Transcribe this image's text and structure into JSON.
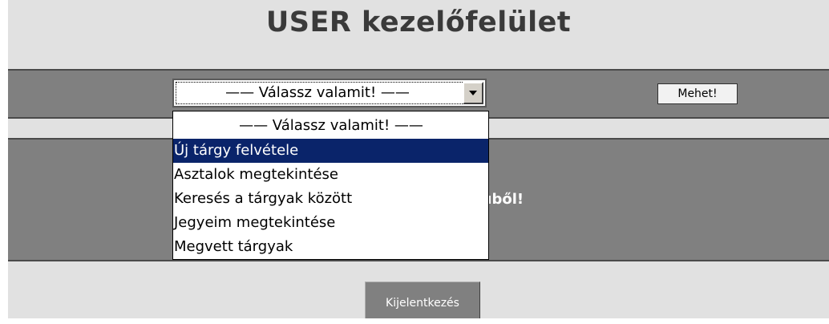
{
  "page": {
    "title": "USER kezelőfelület"
  },
  "menu": {
    "selected_label": "—— Válassz valamit! ——",
    "options": [
      "—— Válassz valamit! ——",
      "Új tárgy felvétele",
      "Asztalok megtekintése",
      "Keresés a tárgyak között",
      "Jegyeim megtekintése",
      "Megvett tárgyak"
    ],
    "highlighted_index": 1,
    "go_label": "Mehet!"
  },
  "content": {
    "message_visible_part": "ti menüből!"
  },
  "footer": {
    "logout_label": "Kijelentkezés"
  },
  "colors": {
    "page_bg": "#e1e1e1",
    "panel_bg": "#808080",
    "highlight": "#0a246a",
    "title": "#3a3a3a"
  },
  "icons": {
    "dropdown_arrow": "chevron-down-icon"
  }
}
